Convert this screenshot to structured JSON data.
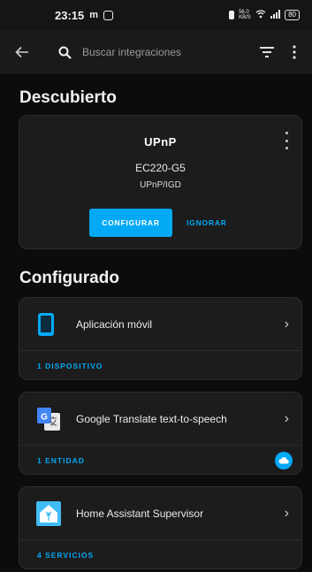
{
  "status_bar": {
    "time": "23:15",
    "left_icons": [
      "m-icon",
      "instagram-icon"
    ],
    "right_icons": [
      "vibrate-icon",
      "wifi-icon",
      "signal-icon"
    ],
    "speed": "56.0 KB/S",
    "battery": "80"
  },
  "appbar": {
    "search_placeholder": "Buscar integraciones"
  },
  "discovered": {
    "title": "Descubierto",
    "logo_text": "UPnP",
    "device_name": "EC220-G5",
    "device_protocol": "UPnP/IGD",
    "configure_label": "CONFIGURAR",
    "ignore_label": "IGNORAR"
  },
  "configured": {
    "title": "Configurado",
    "items": [
      {
        "name": "Aplicación móvil",
        "link": "1 DISPOSITIVO",
        "icon": "phone-icon"
      },
      {
        "name": "Google Translate text-to-speech",
        "link": "1 ENTIDAD",
        "icon": "google-translate-icon",
        "badge": "cloud-icon"
      },
      {
        "name": "Home Assistant Supervisor",
        "link": "4 SERVICIOS",
        "icon": "home-assistant-icon"
      }
    ]
  },
  "colors": {
    "accent": "#03a9f4",
    "background": "#0c0c0c",
    "card": "#1c1c1c"
  }
}
